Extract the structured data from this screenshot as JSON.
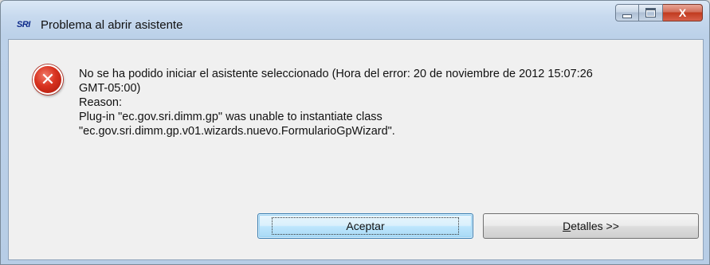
{
  "window": {
    "app_logo": "SRI",
    "title": "Problema al abrir asistente",
    "controls": {
      "minimize": "minimize-icon",
      "maximize": "maximize-icon",
      "close": "close-icon",
      "close_glyph": "X"
    }
  },
  "dialog": {
    "icon": "error-icon",
    "icon_glyph": "✕",
    "message_lines": [
      "No se ha podido iniciar el asistente seleccionado (Hora del error: 20 de noviembre de 2012 15:07:26",
      "GMT-05:00)",
      "Reason:",
      "Plug-in \"ec.gov.sri.dimm.gp\" was unable to instantiate class",
      "\"ec.gov.sri.dimm.gp.v01.wizards.nuevo.FormularioGpWizard\"."
    ],
    "buttons": {
      "accept_label": "Aceptar",
      "details_label_mnemonic": "D",
      "details_label_rest": "etalles >>"
    }
  },
  "colors": {
    "titlebar": "#c7d9ee",
    "client_bg": "#f0f0f0",
    "error_red": "#d8321f",
    "close_button": "#c13a1e"
  }
}
